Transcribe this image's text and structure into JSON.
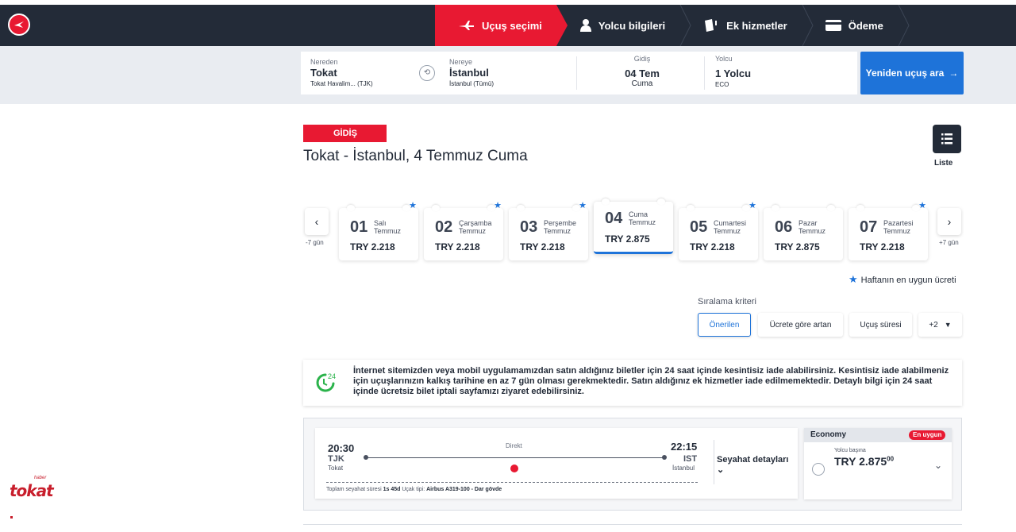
{
  "nav": {
    "steps": [
      {
        "label": "Uçuş seçimi",
        "active": true
      },
      {
        "label": "Yolcu bilgileri",
        "active": false
      },
      {
        "label": "Ek hizmetler",
        "active": false
      },
      {
        "label": "Ödeme",
        "active": false
      }
    ]
  },
  "search": {
    "from_label": "Nereden",
    "from_city": "Tokat",
    "from_airport": "Tokat Havalim... (TJK)",
    "to_label": "Nereye",
    "to_city": "İstanbul",
    "to_airport": "İstanbul (Tümü)",
    "date_label": "Gidiş",
    "date_value": "04 Tem",
    "date_day": "Cuma",
    "pax_label": "Yolcu",
    "pax_value": "1 Yolcu",
    "pax_class": "ECO",
    "button": "Yeniden uçuş ara"
  },
  "leg": {
    "tag": "GİDİŞ",
    "title": "Tokat - İstanbul, 4 Temmuz Cuma",
    "list_label": "Liste"
  },
  "dates": {
    "prev_label": "-7 gün",
    "next_label": "+7 gün",
    "days": [
      {
        "num": "01",
        "weekday": "Salı",
        "month": "Temmuz",
        "price": "TRY 2.218",
        "star": true,
        "selected": false
      },
      {
        "num": "02",
        "weekday": "Çarşamba",
        "month": "Temmuz",
        "price": "TRY 2.218",
        "star": true,
        "selected": false
      },
      {
        "num": "03",
        "weekday": "Perşembe",
        "month": "Temmuz",
        "price": "TRY 2.218",
        "star": true,
        "selected": false
      },
      {
        "num": "04",
        "weekday": "Cuma",
        "month": "Temmuz",
        "price": "TRY 2.875",
        "star": false,
        "selected": true
      },
      {
        "num": "05",
        "weekday": "Cumartesi",
        "month": "Temmuz",
        "price": "TRY 2.218",
        "star": true,
        "selected": false
      },
      {
        "num": "06",
        "weekday": "Pazar",
        "month": "Temmuz",
        "price": "TRY 2.875",
        "star": false,
        "selected": false
      },
      {
        "num": "07",
        "weekday": "Pazartesi",
        "month": "Temmuz",
        "price": "TRY 2.218",
        "star": true,
        "selected": false
      }
    ],
    "legend": "Haftanın en uygun ücreti"
  },
  "sort": {
    "title": "Sıralama kriteri",
    "options": [
      "Önerilen",
      "Ücrete göre artan",
      "Uçuş süresi",
      "+2"
    ]
  },
  "info": {
    "icon_text": "24",
    "text": "İnternet sitemizden veya mobil uygulamamızdan satın aldığınız biletler için 24 saat içinde kesintisiz iade alabilirsiniz. Kesintisiz iade alabilmeniz için uçuşlarınızın kalkış tarihine en az 7 gün olması gerekmektedir. Satın aldığınız ek hizmetler iade edilmemektedir. Detaylı bilgi için 24 saat içinde ücretsiz bilet iptali sayfamızı ziyaret edebilirsiniz."
  },
  "flight": {
    "dep_time": "20:30",
    "dep_code": "TJK",
    "dep_city": "Tokat",
    "arr_time": "22:15",
    "arr_code": "IST",
    "arr_city": "İstanbul",
    "type": "Direkt",
    "duration_label": "Toplam seyahat süresi",
    "duration": "1s 45d",
    "aircraft_label": "Uçak tipi:",
    "aircraft": "Airbus A319-100 - Dar gövde",
    "details": "Seyahat detayları",
    "fare_name": "Economy",
    "fare_badge": "En uygun",
    "per_pax": "Yolcu başına",
    "price": "TRY 2.875",
    "price_decimal": "00"
  },
  "watermark": {
    "brand": "tokat",
    "sup": "haber"
  },
  "colors": {
    "brand_red": "#e81932",
    "nav_dark": "#232b38",
    "accent_blue": "#1e73d9"
  }
}
